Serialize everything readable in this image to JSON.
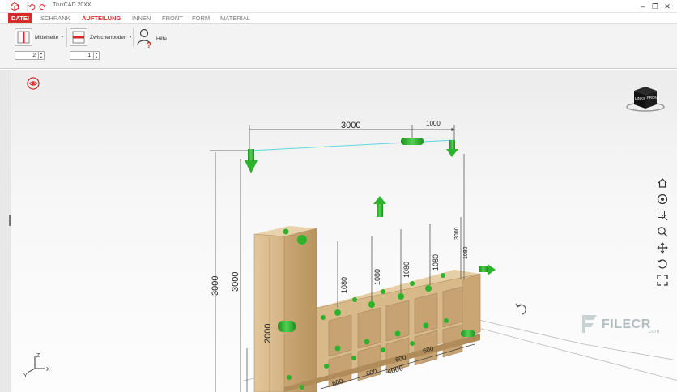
{
  "app": {
    "title": "TruxCAD 20XX"
  },
  "quick_access": {
    "icons": [
      "app-logo-icon",
      "undo-icon",
      "redo-icon"
    ]
  },
  "window_controls": {
    "minimize": "–",
    "restore": "❐",
    "close": "✕"
  },
  "ribbon": {
    "tabs": [
      {
        "label": "DATEI"
      },
      {
        "label": "SCHRANK"
      },
      {
        "label": "AUFTEILUNG"
      },
      {
        "label": "INNEN"
      },
      {
        "label": "FRONT"
      },
      {
        "label": "FORM"
      },
      {
        "label": "MATERIAL"
      }
    ],
    "active_tab": "AUFTEILUNG",
    "buttons": {
      "mittelseite": "Mittelseite",
      "zwischenboden": "Zwischenboden",
      "hilfe": "Hilfe"
    },
    "spinners": {
      "mittelseite_count": "2",
      "zwischenboden_count": "1"
    }
  },
  "viewcube": {
    "left_face": "LINKS",
    "front_face": "FRONT"
  },
  "dimensions": {
    "top_width": "3000",
    "top_right": "1000",
    "outer_height": "3000",
    "inner_height": "3000",
    "tall_column_height": "2000",
    "low_section_height": "1080",
    "right_height": "3000",
    "right_low": "1080",
    "bottom_width": "4000",
    "cell_width": "600"
  },
  "axes": {
    "x": "X",
    "y": "Y",
    "z": "Z"
  },
  "watermark": {
    "brand": "FILECR",
    "sub": ".com"
  },
  "colors": {
    "accent_red": "#d72a2a",
    "wood": "#d8b98a",
    "arrow_green": "#2bb42b",
    "dimension_line": "#555555",
    "guide_cyan": "#5fd7e0"
  },
  "nav_tools": [
    "home-icon",
    "view-icon",
    "zoom-window-icon",
    "zoom-icon",
    "pan-icon",
    "rotate-icon",
    "fit-icon"
  ]
}
